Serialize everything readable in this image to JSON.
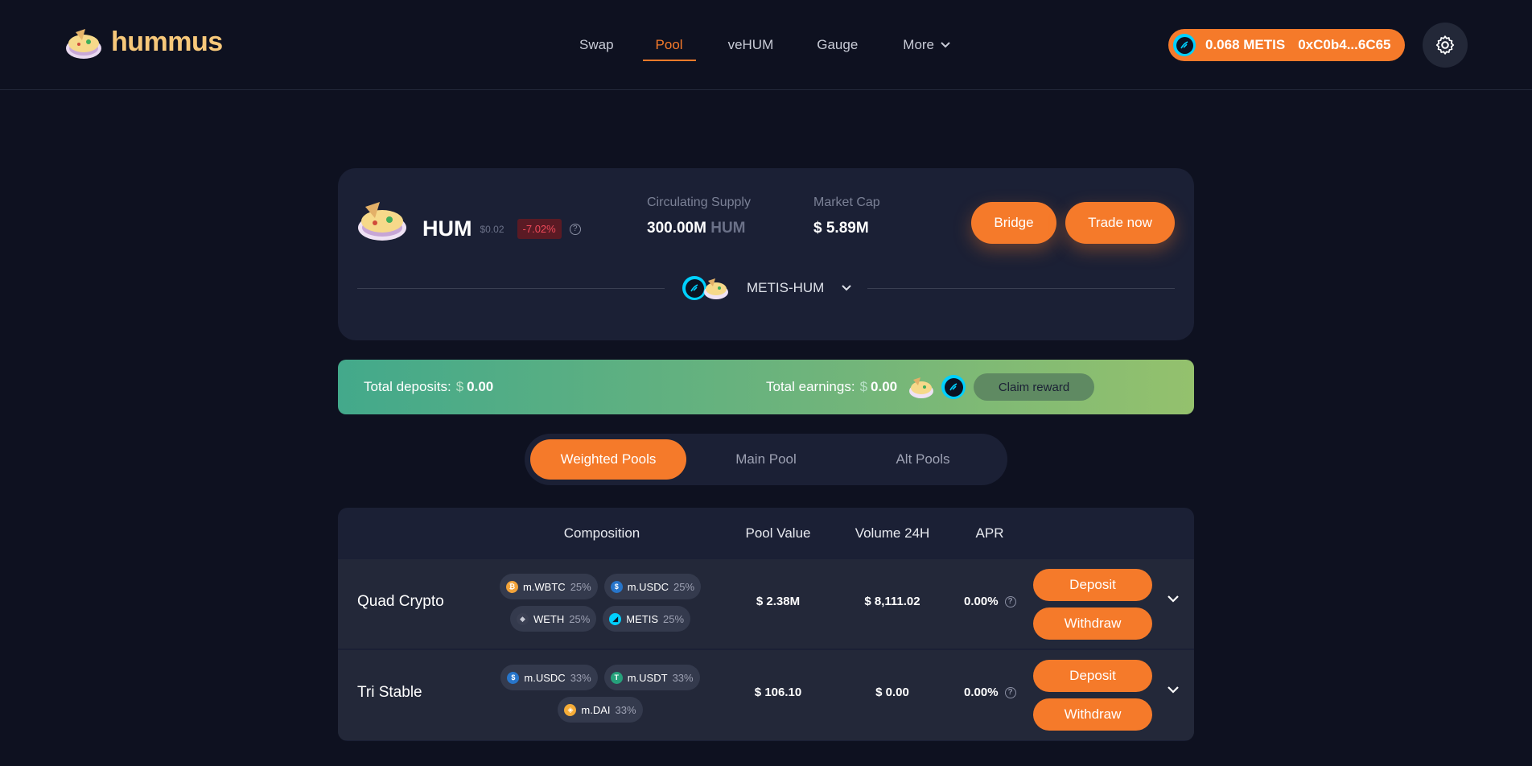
{
  "header": {
    "logo_text": "hummus",
    "nav": [
      {
        "label": "Swap"
      },
      {
        "label": "Pool"
      },
      {
        "label": "veHUM"
      },
      {
        "label": "Gauge"
      },
      {
        "label": "More"
      }
    ],
    "active_nav": "Pool",
    "wallet": {
      "balance": "0.068 METIS",
      "address": "0xC0b4...6C65"
    }
  },
  "token": {
    "symbol": "HUM",
    "price": "$0.02",
    "change": "-7.02%",
    "help_glyph": "?",
    "circulating_label": "Circulating Supply",
    "circulating_value": "300.00M",
    "circulating_unit": "HUM",
    "marketcap_label": "Market Cap",
    "marketcap_value": "$ 5.89M",
    "bridge_label": "Bridge",
    "trade_label": "Trade now",
    "pair_label": "METIS-HUM"
  },
  "totals": {
    "deposits_label": "Total deposits:",
    "currency": "$",
    "deposits_value": "0.00",
    "earnings_label": "Total earnings:",
    "earnings_value": "0.00",
    "claim_label": "Claim reward"
  },
  "tabs": [
    {
      "label": "Weighted Pools"
    },
    {
      "label": "Main Pool"
    },
    {
      "label": "Alt Pools"
    }
  ],
  "active_tab": "Weighted Pools",
  "table": {
    "headers": {
      "composition": "Composition",
      "pool_value": "Pool Value",
      "volume": "Volume 24H",
      "apr": "APR"
    },
    "rows": [
      {
        "name": "Quad Crypto",
        "tokens": [
          {
            "symbol": "m.WBTC",
            "pct": "25%"
          },
          {
            "symbol": "m.USDC",
            "pct": "25%"
          },
          {
            "symbol": "WETH",
            "pct": "25%"
          },
          {
            "symbol": "METIS",
            "pct": "25%"
          }
        ],
        "pool_value": "$ 2.38M",
        "volume": "$ 8,111.02",
        "apr": "0.00%",
        "deposit_label": "Deposit",
        "withdraw_label": "Withdraw"
      },
      {
        "name": "Tri Stable",
        "tokens": [
          {
            "symbol": "m.USDC",
            "pct": "33%"
          },
          {
            "symbol": "m.USDT",
            "pct": "33%"
          },
          {
            "symbol": "m.DAI",
            "pct": "33%"
          }
        ],
        "pool_value": "$ 106.10",
        "volume": "$ 0.00",
        "apr": "0.00%",
        "deposit_label": "Deposit",
        "withdraw_label": "Withdraw"
      }
    ]
  },
  "colors": {
    "accent": "#f57a2a",
    "background": "#0e1120",
    "card": "#1b2035",
    "negative": "#f04a5a"
  },
  "icons": [
    "hummus-bowl-icon",
    "metis-icon",
    "gear-icon",
    "chevron-down-icon",
    "help-icon",
    "wbtc-icon",
    "usdc-icon",
    "weth-icon",
    "usdt-icon",
    "dai-icon"
  ]
}
